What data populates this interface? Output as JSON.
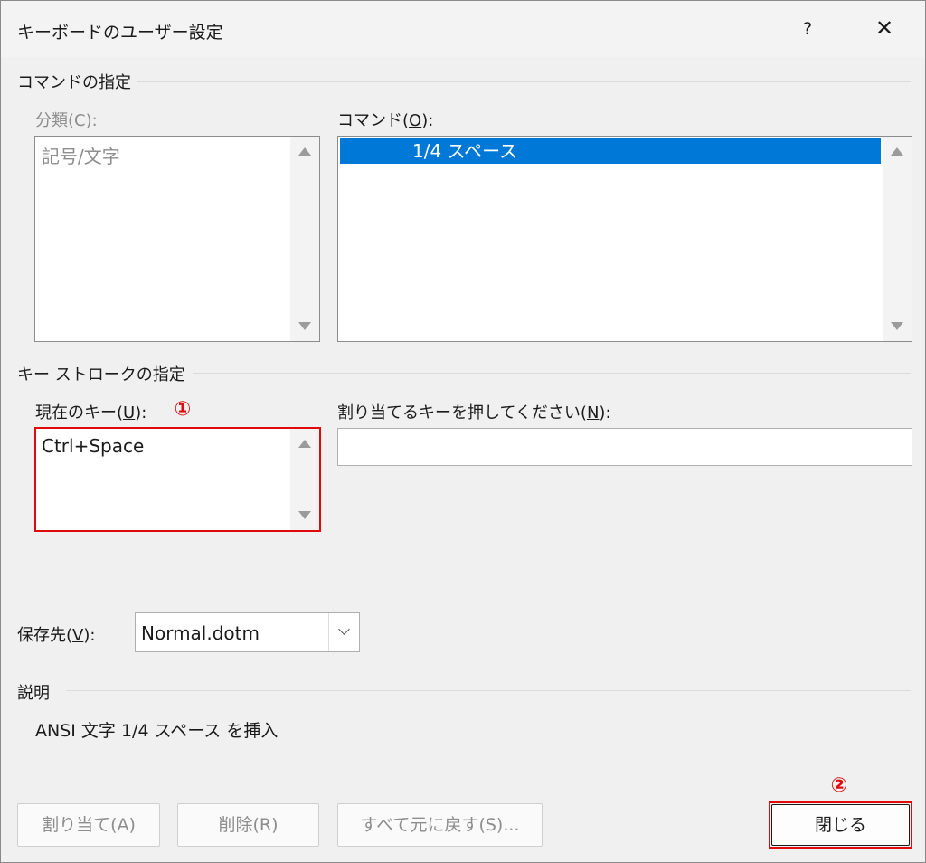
{
  "window": {
    "title": "キーボードのユーザー設定",
    "help": "?",
    "close": "✕"
  },
  "command_section": {
    "header": "コマンドの指定",
    "category_label": "分類(C):",
    "category_items": [
      "記号/文字"
    ],
    "command_label_prefix": "コマンド(",
    "command_label_key": "O",
    "command_label_suffix": "):",
    "command_items": [
      "1/4 スペース"
    ]
  },
  "keystroke_section": {
    "header": "キー ストロークの指定",
    "current_key_label_prefix": "現在のキー(",
    "current_key_label_key": "U",
    "current_key_label_suffix": "):",
    "current_keys": [
      "Ctrl+Space"
    ],
    "new_key_label_prefix": "割り当てるキーを押してください(",
    "new_key_label_key": "N",
    "new_key_label_suffix": "):",
    "new_key_value": ""
  },
  "save_in": {
    "label_prefix": "保存先(",
    "label_key": "V",
    "label_suffix": "):",
    "value": "Normal.dotm"
  },
  "description": {
    "header": "説明",
    "text": "ANSI 文字 1/4 スペース を挿入"
  },
  "buttons": {
    "assign": "割り当て(A)",
    "remove": "削除(R)",
    "reset_all": "すべて元に戻す(S)...",
    "close": "閉じる"
  },
  "annotations": {
    "marker_1": "①",
    "marker_2": "②",
    "color": "#e00a0a"
  },
  "colors": {
    "selection": "#0078d7",
    "background": "#f0f0f0"
  }
}
